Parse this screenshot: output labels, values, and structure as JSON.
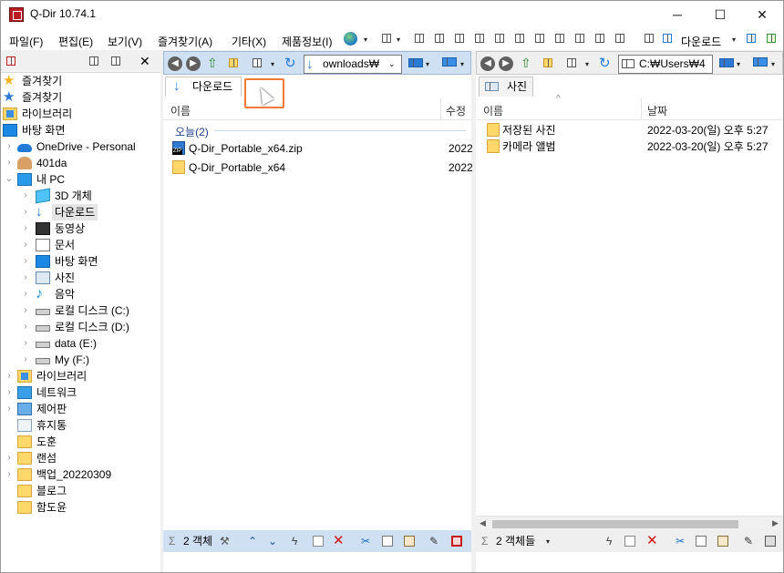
{
  "window": {
    "title": "Q-Dir 10.74.1",
    "min_glyph": "─",
    "max_glyph": "☐",
    "close_glyph": "✕"
  },
  "menu": {
    "items": [
      "파일(F)",
      "편집(E)",
      "보기(V)",
      "즐겨찾기(A)",
      "기타(X)",
      "제품정보(I)"
    ],
    "download_label": "다운로드",
    "caret": "▾"
  },
  "tree": {
    "items": [
      {
        "label": "즐겨찾기",
        "icon": "star-icon",
        "indent": 0,
        "expander": ""
      },
      {
        "label": "즐겨찾기",
        "icon": "blue-star-icon",
        "indent": 0,
        "expander": ""
      },
      {
        "label": "라이브러리",
        "icon": "library-icon",
        "indent": 0,
        "expander": ""
      },
      {
        "label": "바탕 화면",
        "icon": "desktop-icon",
        "indent": 0,
        "expander": ""
      },
      {
        "label": "OneDrive - Personal",
        "icon": "cloud-icon",
        "indent": 1,
        "expander": "›"
      },
      {
        "label": "401da",
        "icon": "user-icon",
        "indent": 1,
        "expander": "›"
      },
      {
        "label": "내 PC",
        "icon": "pc-icon",
        "indent": 1,
        "expander": "⌄"
      },
      {
        "label": "3D 개체",
        "icon": "3d-objects-icon",
        "indent": 2,
        "expander": "›"
      },
      {
        "label": "다운로드",
        "icon": "download-icon",
        "indent": 2,
        "expander": "›",
        "selected": true
      },
      {
        "label": "동영상",
        "icon": "video-icon",
        "indent": 2,
        "expander": "›"
      },
      {
        "label": "문서",
        "icon": "document-icon",
        "indent": 2,
        "expander": "›"
      },
      {
        "label": "바탕 화면",
        "icon": "desktop-icon",
        "indent": 2,
        "expander": "›"
      },
      {
        "label": "사진",
        "icon": "picture-icon",
        "indent": 2,
        "expander": "›"
      },
      {
        "label": "음악",
        "icon": "music-icon",
        "indent": 2,
        "expander": "›"
      },
      {
        "label": "로컬 디스크 (C:)",
        "icon": "drive-c-icon",
        "indent": 2,
        "expander": "›"
      },
      {
        "label": "로컬 디스크 (D:)",
        "icon": "drive-icon",
        "indent": 2,
        "expander": "›"
      },
      {
        "label": "data (E:)",
        "icon": "drive-icon",
        "indent": 2,
        "expander": "›"
      },
      {
        "label": "My (F:)",
        "icon": "drive-icon",
        "indent": 2,
        "expander": "›"
      },
      {
        "label": "라이브러리",
        "icon": "library-icon",
        "indent": 1,
        "expander": "›"
      },
      {
        "label": "네트워크",
        "icon": "network-icon",
        "indent": 1,
        "expander": "›"
      },
      {
        "label": "제어판",
        "icon": "control-panel-icon",
        "indent": 1,
        "expander": "›"
      },
      {
        "label": "휴지통",
        "icon": "recycle-bin-icon",
        "indent": 1,
        "expander": ""
      },
      {
        "label": "도훈",
        "icon": "folder-icon",
        "indent": 1,
        "expander": ""
      },
      {
        "label": "랜섬",
        "icon": "folder-icon",
        "indent": 1,
        "expander": "›"
      },
      {
        "label": "백업_20220309",
        "icon": "folder-icon",
        "indent": 1,
        "expander": "›"
      },
      {
        "label": "블로그",
        "icon": "folder-icon",
        "indent": 1,
        "expander": ""
      },
      {
        "label": "함도윤",
        "icon": "folder-icon",
        "indent": 1,
        "expander": ""
      }
    ]
  },
  "left_pane": {
    "address": "ownloads₩",
    "tab_label": "다운로드",
    "col_name": "이름",
    "col_modified": "수정",
    "group_label": "오늘(2)",
    "files": [
      {
        "name": "Q-Dir_Portable_x64.zip",
        "date": "2022",
        "icon": "zip-icon"
      },
      {
        "name": "Q-Dir_Portable_x64",
        "date": "2022",
        "icon": "folder-icon"
      }
    ],
    "status": "2 객체",
    "sigma": "Σ"
  },
  "right_pane": {
    "address": "C:₩Users₩4",
    "tab_label": "사진",
    "col_name": "이름",
    "col_date": "날짜",
    "files": [
      {
        "name": "저장된 사진",
        "date": "2022-03-20(일) 오후 5:27",
        "icon": "folder-icon"
      },
      {
        "name": "카메라 앨범",
        "date": "2022-03-20(일) 오후 5:27",
        "icon": "folder-icon"
      }
    ],
    "status": "2 객체들",
    "sigma": "Σ"
  },
  "colors": {
    "active_toolbar": "#cfe0f3",
    "highlight": "#f07a3a",
    "group_text": "#1e3e8e"
  }
}
